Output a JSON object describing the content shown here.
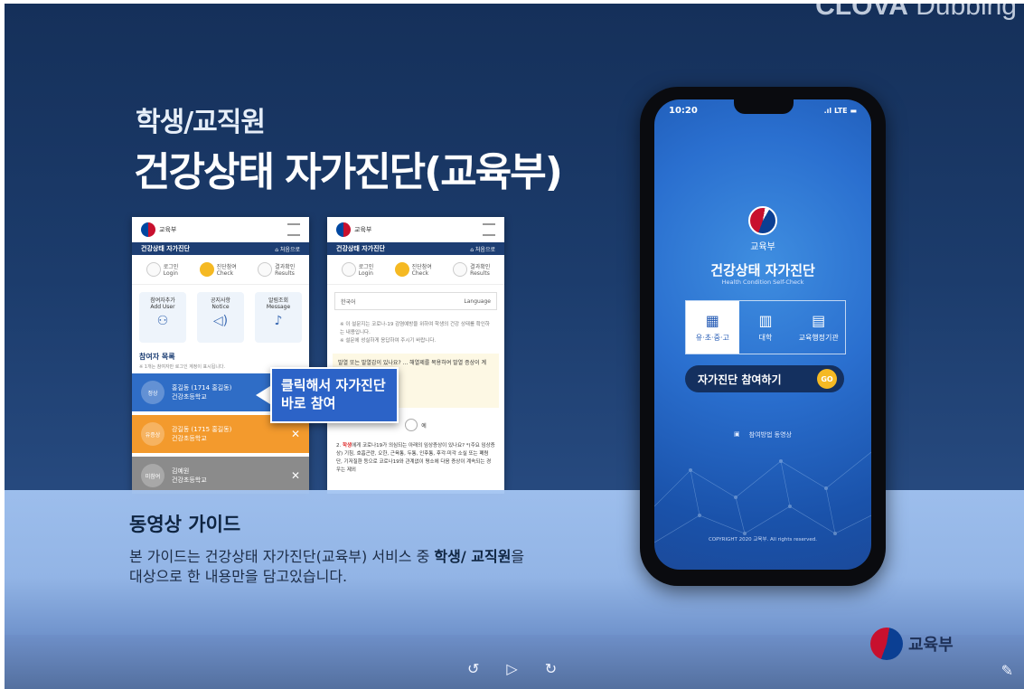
{
  "watermark": {
    "brand": "CLOVA",
    "product": "Dubbing"
  },
  "hero": {
    "subtitle": "학생/교직원",
    "title": "건강상태 자가진단(교육부)"
  },
  "mini1": {
    "logo_text": "교육부",
    "header": "건강상태 자가진단",
    "home": "처음으로",
    "steps": [
      {
        "ko": "로그인",
        "en": "Login"
      },
      {
        "ko": "진단참여",
        "en": "Check"
      },
      {
        "ko": "결과확인",
        "en": "Results"
      }
    ],
    "menus": [
      {
        "ko": "참여자추가",
        "en": "Add User"
      },
      {
        "ko": "공지사항",
        "en": "Notice"
      },
      {
        "ko": "알림조회",
        "en": "Message"
      }
    ],
    "list_title": "참여자 목록",
    "list_sub": "※ 1개는 참여자만 로그인 계정이 표시됩니다.",
    "rows": [
      {
        "badge": "정상",
        "name": "홍길동 (1714 홍길동)",
        "school": "건강초등학교"
      },
      {
        "badge": "유증상",
        "name": "강길동 (1715 홍길동)",
        "school": "건강초등학교"
      },
      {
        "badge": "미참여",
        "name": "김예원",
        "school": "건강초등학교"
      }
    ]
  },
  "mini2": {
    "logo_text": "교육부",
    "header": "건강상태 자가진단",
    "home": "처음으로",
    "lang_value": "한국어",
    "lang_label": "Language",
    "notes": [
      "※ 이 설문지는 코로나-19 감염예방을 위하여 학생의 건강 상태를 확인하는 내용입니다.",
      "※ 설문에 성실하게 응답하여 주시기 바랍니다."
    ],
    "q1": "발열 또는 발열감이 있나요? ... 해열제를 복용하여 발열 증상이 계",
    "radio_label": "예",
    "q2_prefix": "2.",
    "q2_hl": "학생",
    "q2_text": "에게 코로나19가 의심되는 아래의 임상증상이 있나요? *(주요 임상증상) 기침, 호흡곤란, 오한, 근육통, 두통, 인후통, 후각·미각 소실 또는 폐렴 단, 기저질환 등으로 코로나19와 관계없이 평소에 다음 증상이 계속되는 경우는 제외"
  },
  "callout": {
    "line1": "클릭해서 자가진단",
    "line2": "바로 참여"
  },
  "guide": {
    "title": "동영상 가이드",
    "line1_a": "본 가이드는 건강상태 자가진단(교육부) 서비스 중 ",
    "line1_b": "학생/ 교직원",
    "line1_c": "을",
    "line2": "대상으로 한 내용만을 담고있습니다."
  },
  "phone": {
    "time": "10:20",
    "network": "LTE",
    "ministry": "교육부",
    "app_title": "건강상태 자가진단",
    "app_sub": "Health Condition Self-Check",
    "tabs": [
      "유·초·중·고",
      "대학",
      "교육행정기관"
    ],
    "join_label": "자가진단 참여하기",
    "go_label": "GO",
    "video_link": "참여방법 동영상",
    "copyright": "COPYRIGHT 2020 교육부. All rights reserved."
  },
  "footer_logo": "교육부",
  "controls": {
    "rewind": "↺",
    "play": "▷",
    "forward": "↻"
  },
  "icons": [
    "replay-10-icon",
    "play-icon",
    "forward-30-icon",
    "pen-icon"
  ]
}
